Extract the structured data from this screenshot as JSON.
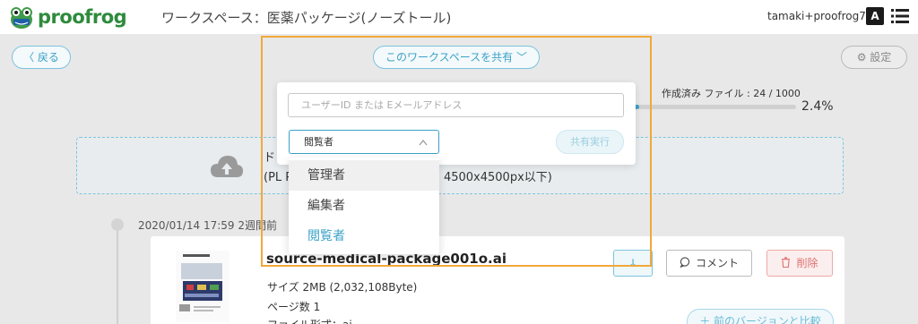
{
  "header": {
    "logo_text": "proofrog",
    "workspace_title": "ワークスペース：医薬パッケージ(ノーズトール)",
    "user_name": "tamaki+proofrog7",
    "translate_label": "A"
  },
  "toolbar": {
    "back_label": "〈 戻る",
    "share_toggle_label": "このワークスペースを共有 ﹀",
    "settings_label": "⚙ 設定"
  },
  "progress": {
    "label": "作成済み ファイル : 24 / 1000",
    "percent_text": "2.4%",
    "fraction": 0.024
  },
  "dropzone": {
    "line1": "ド",
    "line2": "(PL                                    PNG, PSD形式・20MB以内・4500x4500px以下)"
  },
  "timeline": {
    "timestamp": "2020/01/14 17:59   2週間前"
  },
  "file": {
    "name": "source-medical-package001o.ai",
    "size_label": "サイズ",
    "size_value": "2MB (2,032,108Byte)",
    "pages_label": "ページ数",
    "pages_value": "1",
    "format_label": "ファイル形式：ai",
    "download_icon": "↓",
    "comment_label": "コメント",
    "delete_label": "削除",
    "compare_label": "＋  前のバージョンと比較"
  },
  "share_popover": {
    "input_placeholder": "ユーザーID または Eメールアドレス",
    "input_value": "",
    "selected_role": "閲覧者",
    "share_exec_label": "共有実行",
    "role_options": [
      "管理者",
      "編集者",
      "閲覧者"
    ]
  },
  "colors": {
    "accent": "#3aa2c8",
    "brand_green": "#2e8b3c",
    "highlight": "#f2a83b",
    "danger": "#e07070"
  }
}
